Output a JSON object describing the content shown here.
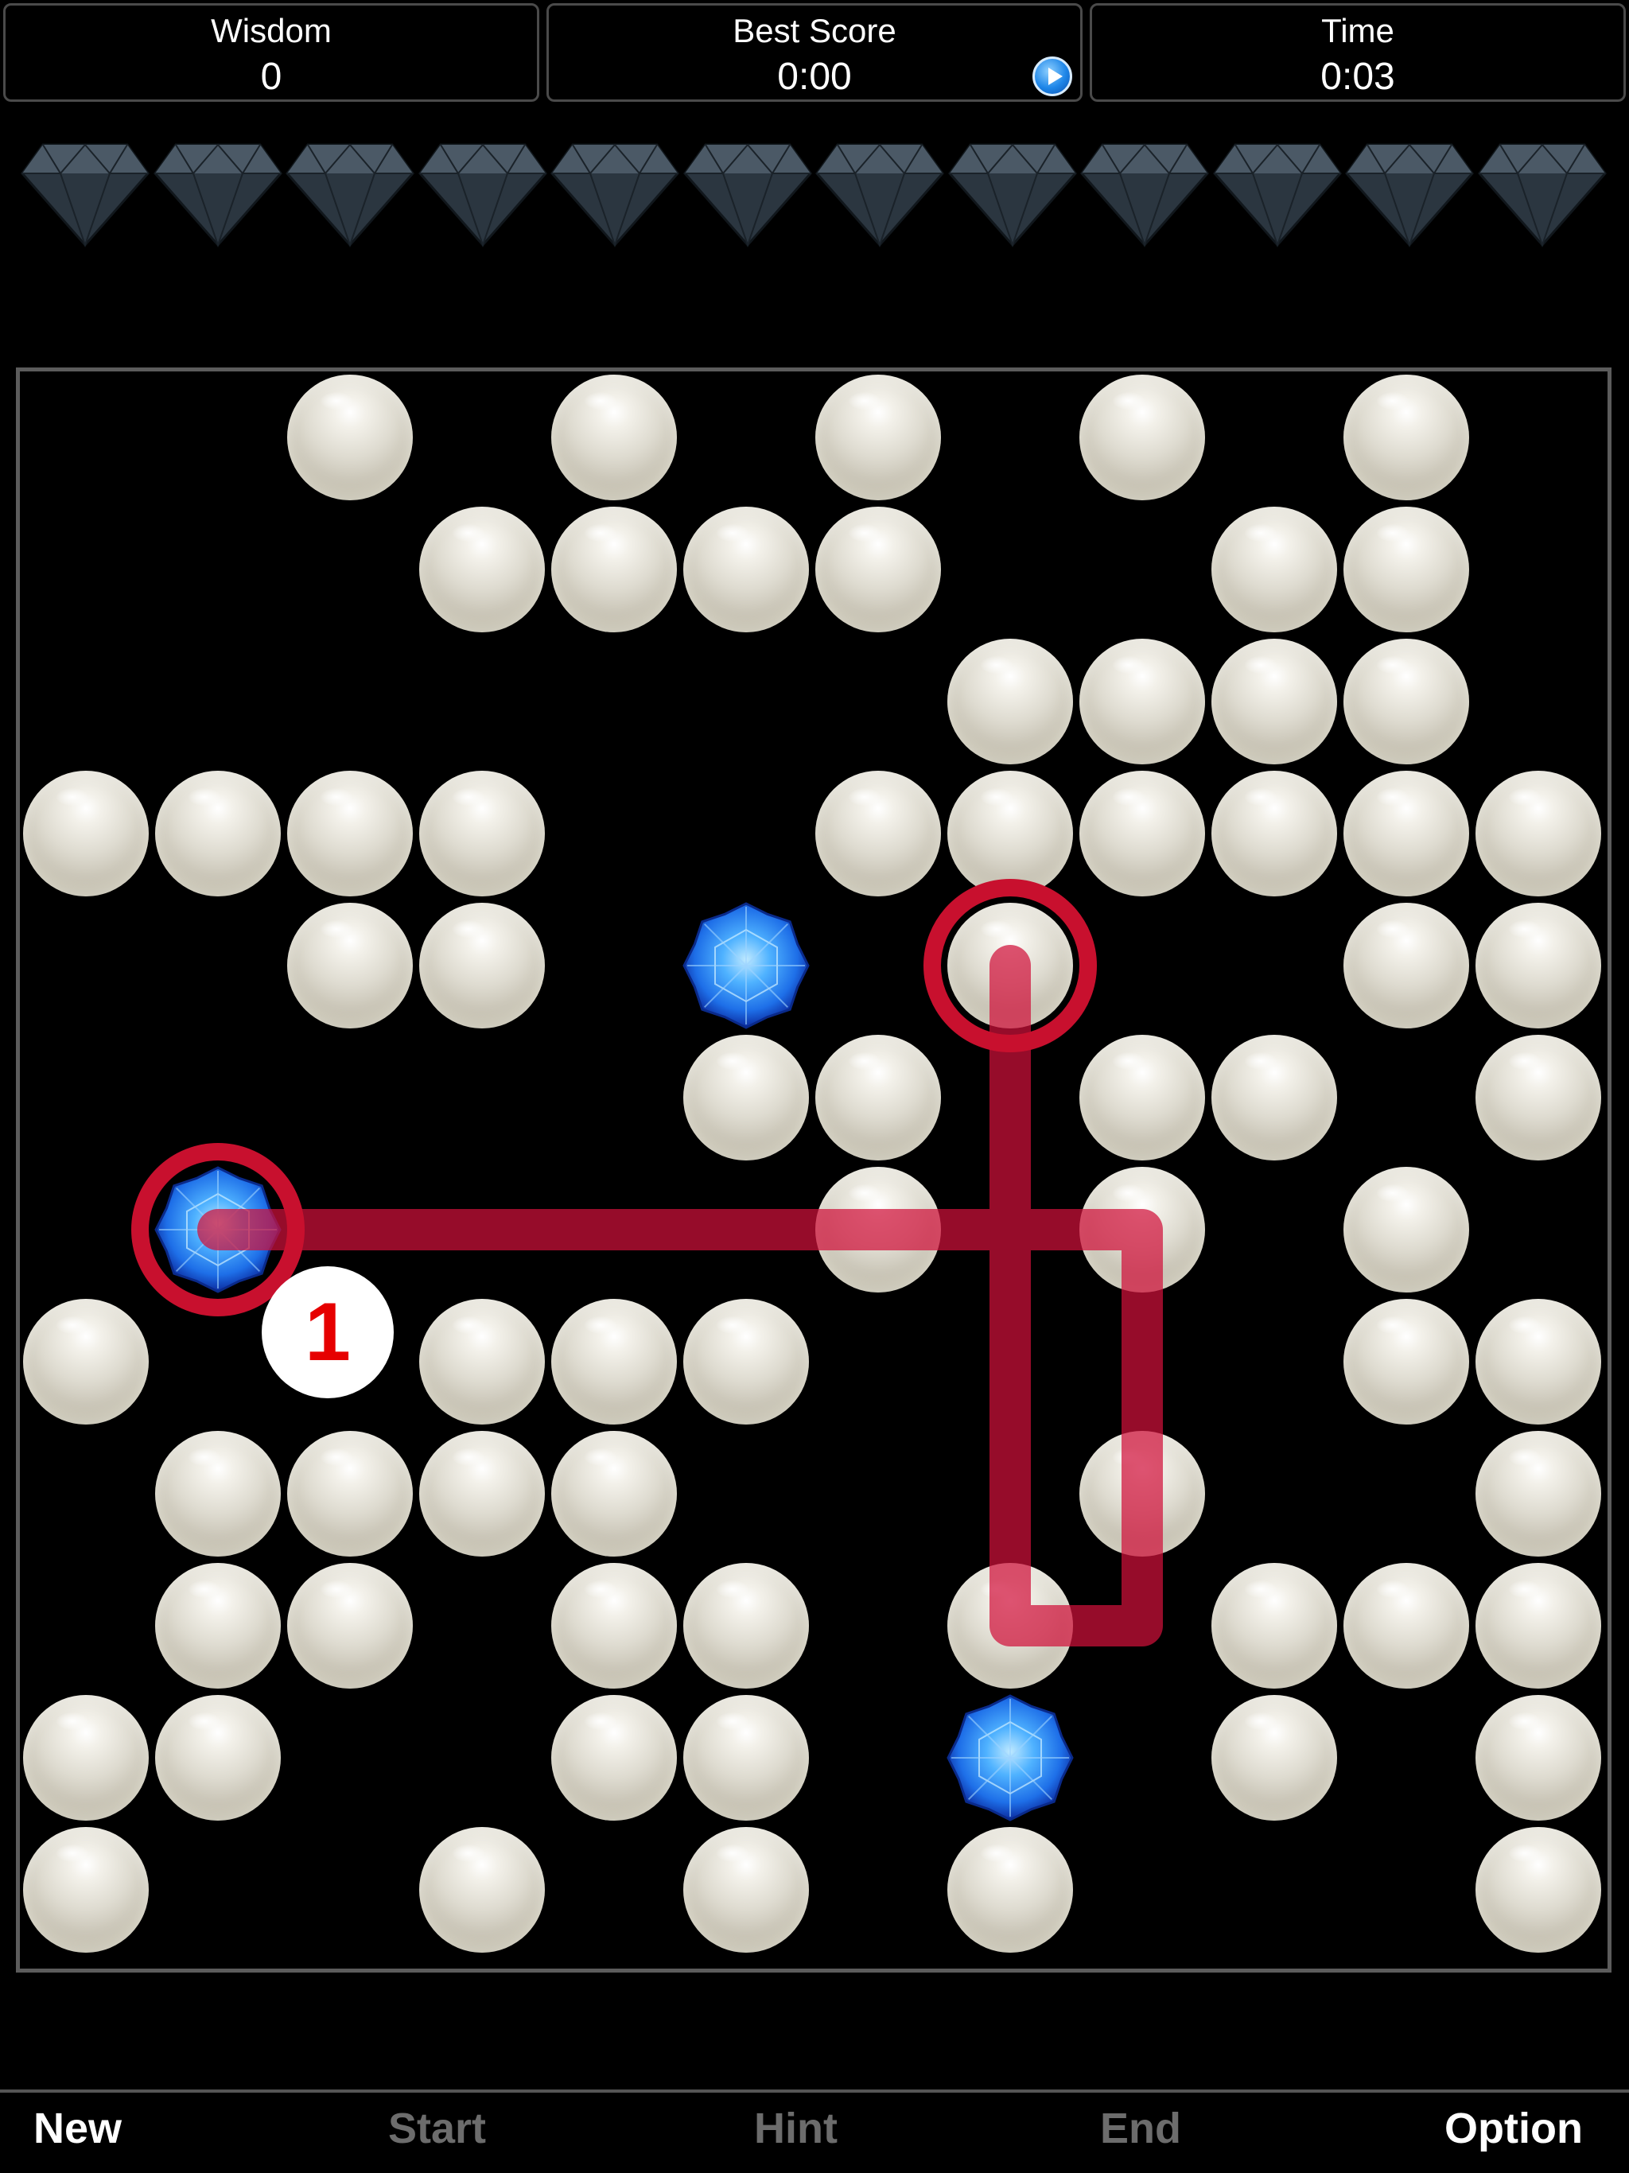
{
  "header": {
    "wisdom": {
      "label": "Wisdom",
      "value": "0"
    },
    "best_score": {
      "label": "Best Score",
      "value": "0:00"
    },
    "time": {
      "label": "Time",
      "value": "0:03"
    }
  },
  "remaining_gems": 12,
  "board": {
    "rows": [
      "..P.P.P.P.P.",
      "...PPPP..PP.",
      ".......PPPP.",
      "PPPP..PPPPPP",
      "..PP.S.P..PP",
      ".....PP.PP.P",
      ".S....P.P.P.",
      "P..PPP....PP",
      ".PPPP...P..P",
      ".PP.PP.P.PPP",
      "PP..PP.S.P.P",
      "P..P.P.P...P"
    ],
    "legend": {
      "P": "pearl",
      "S": "sapphire",
      ".": "empty"
    },
    "selected": [
      [
        6,
        1
      ],
      [
        4,
        7
      ]
    ],
    "path": [
      [
        6,
        1
      ],
      [
        6,
        8
      ],
      [
        9,
        8
      ],
      [
        9,
        7
      ],
      [
        4,
        7
      ]
    ],
    "step_number": "1"
  },
  "toolbar": {
    "new": "New",
    "start": "Start",
    "hint": "Hint",
    "end": "End",
    "option": "Option"
  },
  "colors": {
    "path": "#d0103a",
    "selection_ring": "#c8102e",
    "sapphire": "#1e6fe8",
    "step_number": "#e60000",
    "disabled_text": "#6c6c6c"
  }
}
